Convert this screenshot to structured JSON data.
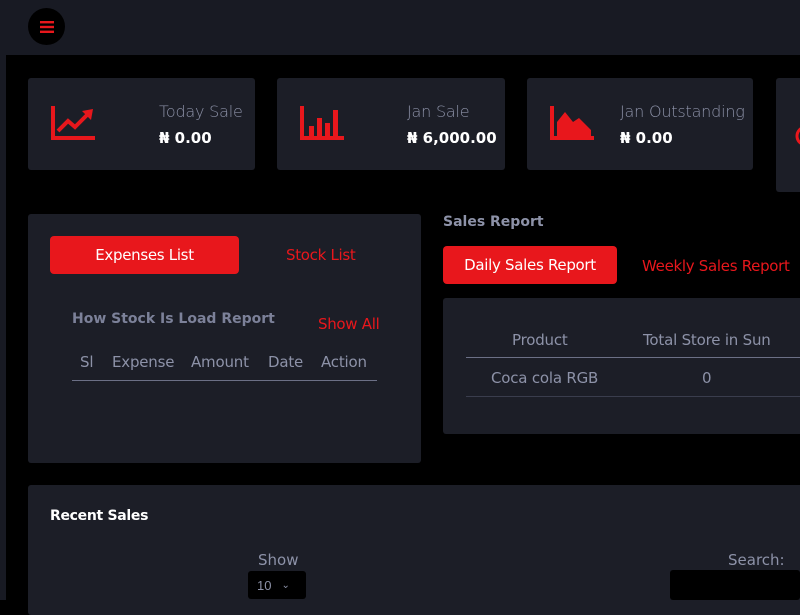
{
  "header": {
    "menu_icon": "hamburger-menu-icon"
  },
  "stats": [
    {
      "label": "Today Sale",
      "value": "₦ 0.00",
      "icon": "trending-chart-icon"
    },
    {
      "label": "Jan Sale",
      "value": "₦ 6,000.00",
      "icon": "bar-chart-icon"
    },
    {
      "label": "Jan Outstanding",
      "value": "₦ 0.00",
      "icon": "area-chart-icon"
    }
  ],
  "expenses_panel": {
    "tab_active": "Expenses List",
    "tab_inactive": "Stock List",
    "report_title": "How Stock Is Load Report",
    "show_all": "Show All",
    "columns": [
      "Sl",
      "Expense",
      "Amount",
      "Date",
      "Action"
    ]
  },
  "sales_report": {
    "heading": "Sales Report",
    "tab_active": "Daily Sales Report",
    "tab_inactive": "Weekly Sales Report",
    "columns": [
      "Product",
      "Total Store in Sun"
    ],
    "rows": [
      {
        "product": "Coca cola RGB",
        "total": "0"
      }
    ]
  },
  "recent_sales": {
    "title": "Recent Sales",
    "show_label": "Show",
    "show_value": "10",
    "search_label": "Search:"
  },
  "colors": {
    "accent": "#e8171c",
    "card": "#1c1e27",
    "topbar": "#181a23",
    "background": "#000000"
  }
}
